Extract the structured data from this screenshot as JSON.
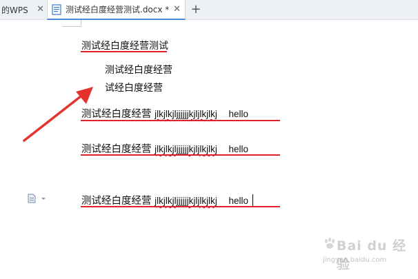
{
  "tabs": {
    "prev_label": "的WPS",
    "active_label": "测试经白度经营测试.docx *",
    "close_symbol": "✕",
    "new_tab_symbol": "+"
  },
  "document": {
    "heading": "测试经白度经营测试",
    "indented_lines": [
      "测试经白度经营",
      "试经白度经营"
    ],
    "rows": [
      {
        "cn": "测试经白度经营",
        "latin": "jlkjlkjljjjjjjkjljlkjlkj",
        "hello": "hello"
      },
      {
        "cn": "测试经白度经营",
        "latin": "jlkjlkjljjjjjjkjljlkjlkj",
        "hello": "hello"
      },
      {
        "cn": "测试经白度经营",
        "latin": "jlkjlkjljjjjjjkjljlkjlkj",
        "hello": "hello"
      }
    ]
  },
  "annotation": {
    "color": "#e5322d"
  },
  "watermark": {
    "text": "Bai du 经验",
    "sub": "jingyan.baidu.com"
  },
  "colors": {
    "underline": "#e0202a",
    "tab_accent": "#4a86d8"
  }
}
